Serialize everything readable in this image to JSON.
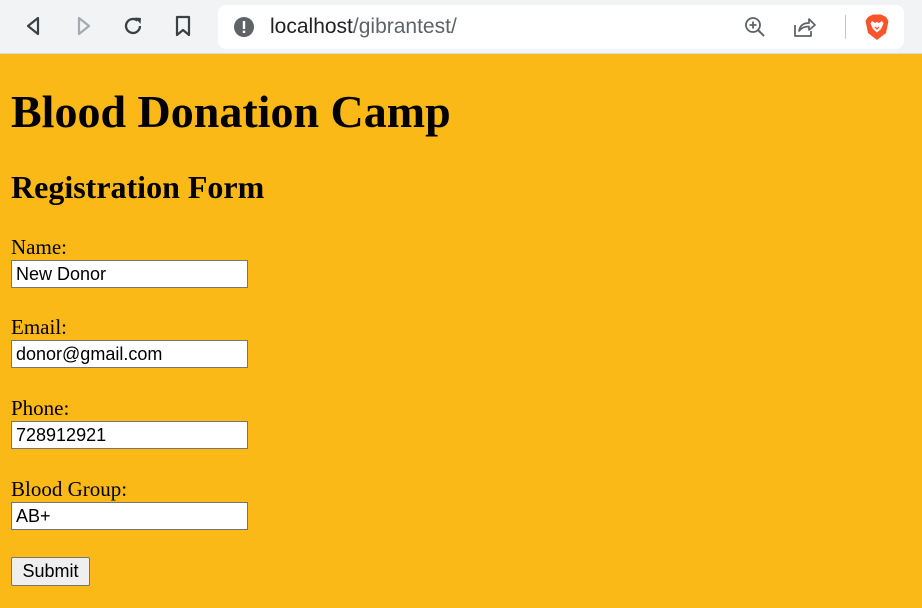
{
  "browser": {
    "url_host": "localhost",
    "url_path": "/gibrantest/",
    "icons": {
      "back": "back-arrow-icon",
      "forward": "forward-arrow-icon",
      "reload": "reload-icon",
      "bookmark": "bookmark-icon",
      "site_info": "site-info-icon",
      "zoom": "zoom-in-icon",
      "share": "share-icon",
      "brave": "brave-shield-icon"
    },
    "colors": {
      "brave_orange": "#fb542b",
      "toolbar": "#f1f3f4"
    }
  },
  "page": {
    "background": "#fbb917",
    "title": "Blood Donation Camp",
    "subtitle": "Registration Form",
    "form": {
      "fields": [
        {
          "label": "Name:",
          "value": "New Donor"
        },
        {
          "label": "Email:",
          "value": "donor@gmail.com"
        },
        {
          "label": "Phone:",
          "value": "728912921"
        },
        {
          "label": "Blood Group:",
          "value": "AB+"
        }
      ],
      "submit_label": "Submit"
    }
  }
}
